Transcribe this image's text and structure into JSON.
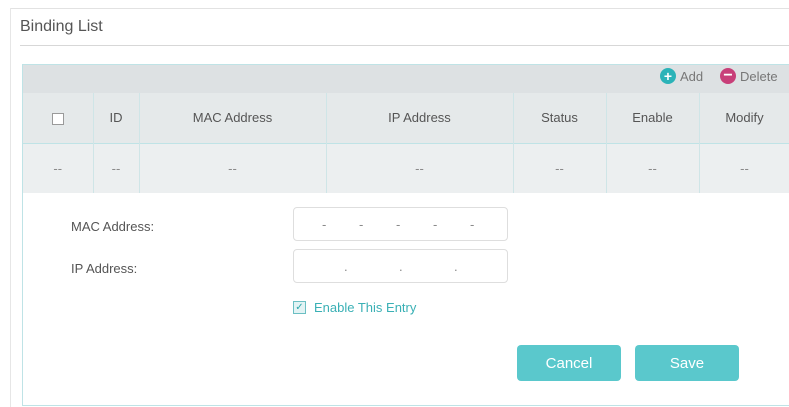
{
  "section_title": "Binding List",
  "toolbar": {
    "add_label": "Add",
    "add_icon": "+",
    "delete_label": "Delete",
    "delete_icon": "−"
  },
  "table": {
    "columns": [
      "ID",
      "MAC Address",
      "IP Address",
      "Status",
      "Enable",
      "Modify"
    ],
    "empty_row": [
      "--",
      "--",
      "--",
      "--",
      "--",
      "--",
      "--"
    ]
  },
  "form": {
    "mac_label": "MAC Address:",
    "ip_label": "IP Address:",
    "mac_separator": "-",
    "ip_separator": ".",
    "enable_label": "Enable This Entry",
    "enable_checked": true,
    "checkmark": "✓"
  },
  "buttons": {
    "cancel": "Cancel",
    "save": "Save"
  },
  "colors": {
    "accent": "#5ac8cc",
    "add_icon": "#2bb3b8",
    "delete_icon": "#c83f79"
  }
}
